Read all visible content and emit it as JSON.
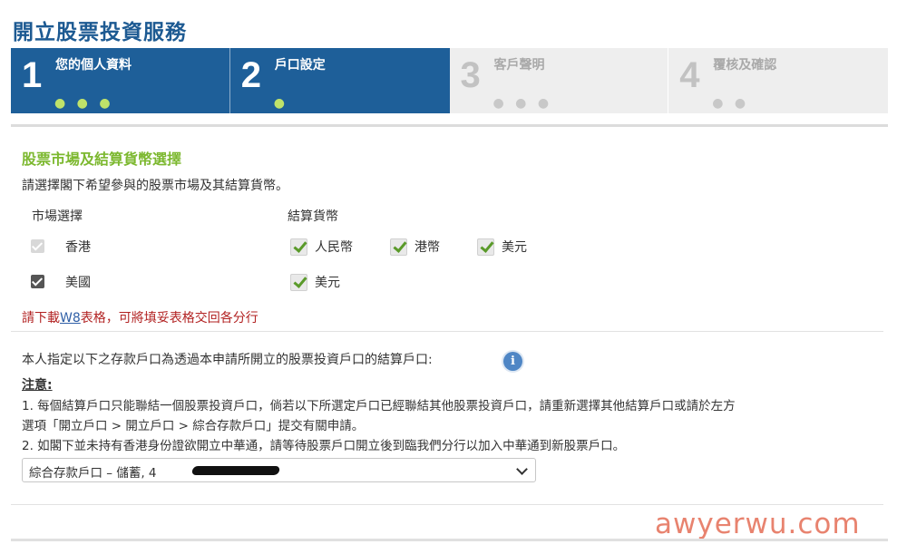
{
  "page_title": "開立股票投資服務",
  "steps": [
    {
      "number": "1",
      "label": "您的個人資料",
      "dots": "● ● ●",
      "state": "active"
    },
    {
      "number": "2",
      "label": "戶口設定",
      "dots": "●",
      "state": "active"
    },
    {
      "number": "3",
      "label": "客戶聲明",
      "dots": "● ● ●",
      "state": "inactive"
    },
    {
      "number": "4",
      "label": "覆核及確認",
      "dots": "● ●",
      "state": "inactive"
    }
  ],
  "market_section": {
    "title": "股票市場及結算貨幣選擇",
    "intro": "請選擇閣下希望參與的股票市場及其結算貨幣。",
    "market_header": "市場選擇",
    "currency_header": "結算貨幣",
    "markets": [
      {
        "name": "香港",
        "checked": true,
        "disabled": true,
        "currencies": [
          "人民幣",
          "港幣",
          "美元"
        ]
      },
      {
        "name": "美國",
        "checked": true,
        "disabled": false,
        "currencies": [
          "美元"
        ]
      }
    ]
  },
  "w8_notice": {
    "prefix": "請下載",
    "link": "W8",
    "suffix": "表格，可將填妥表格交回各分行"
  },
  "settlement": {
    "designate_text": "本人指定以下之存款戶口為透過本申請所開立的股票投資戶口的結算戶口:",
    "info_icon": "i",
    "note_title": "注意:",
    "notes": [
      "1. 每個結算戶口只能聯結一個股票投資戶口，倘若以下所選定戶口已經聯結其他股票投資戶口，請重新選擇其他結算戶口或請於左方",
      "選項「開立戶口 > 開立戶口 > 綜合存款戶口」提交有關申請。",
      "2. 如閣下並未持有香港身份證欲開立中華通，請等待股票戶口開立後到臨我們分行以加入中華通到新股票戶口。"
    ],
    "account_select_value": "綜合存款戶口 – 儲蓄, 4"
  },
  "watermark": "awyerwu.com",
  "colors": {
    "title_blue": "#1d5a92",
    "active_step": "#1e5f99",
    "section_green": "#7cb82f",
    "notice_red": "#b22222"
  }
}
